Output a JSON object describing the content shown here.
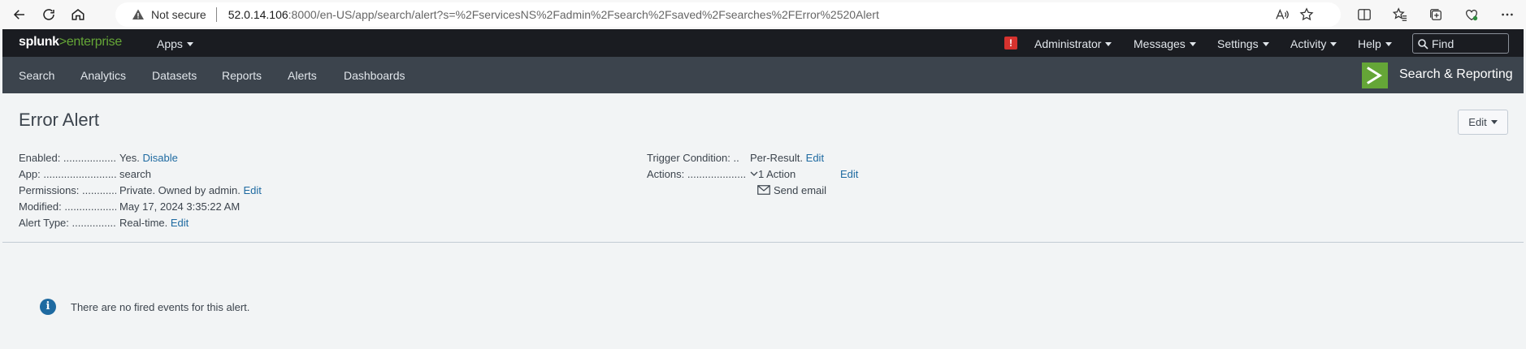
{
  "browser": {
    "security_label": "Not secure",
    "url_host": "52.0.14.106",
    "url_rest": ":8000/en-US/app/search/alert?s=%2FservicesNS%2Fadmin%2Fsearch%2Fsaved%2Fsearches%2FError%2520Alert"
  },
  "topbar": {
    "logo_brand": "splunk",
    "logo_arrow": ">",
    "logo_product": "enterprise",
    "apps_label": "Apps",
    "alert_badge": "!",
    "administrator_label": "Administrator",
    "messages_label": "Messages",
    "settings_label": "Settings",
    "activity_label": "Activity",
    "help_label": "Help",
    "find_placeholder": "Find"
  },
  "appnav": {
    "items": [
      "Search",
      "Analytics",
      "Datasets",
      "Reports",
      "Alerts",
      "Dashboards"
    ],
    "app_title": "Search & Reporting",
    "app_logo_glyph": ">"
  },
  "alert": {
    "title": "Error Alert",
    "edit_label": "Edit",
    "enabled_label": "Enabled: ......................................",
    "enabled_value": "Yes.",
    "enabled_link": "Disable",
    "app_label": "App: ....................................................",
    "app_value": "search",
    "permissions_label": "Permissions: ..............................",
    "permissions_value": "Private. Owned by admin.",
    "permissions_link": "Edit",
    "modified_label": "Modified: .....................................",
    "modified_value": "May 17, 2024 3:35:22 AM",
    "alert_type_label": "Alert Type: .................................",
    "alert_type_value": "Real-time.",
    "alert_type_link": "Edit",
    "trigger_label": "Trigger Condition: ..",
    "trigger_value": "Per-Result.",
    "trigger_link": "Edit",
    "actions_label": "Actions: ..............................",
    "actions_value": "1 Action",
    "actions_link": "Edit",
    "action_item": "Send email"
  },
  "events": {
    "info_glyph": "i",
    "empty_message": "There are no fired events for this alert."
  },
  "colors": {
    "topbar_bg": "#1a1c21",
    "appnav_bg": "#3c444d",
    "accent_green": "#65a637",
    "link_blue": "#1e6aa1",
    "alert_red": "#d6322e"
  }
}
